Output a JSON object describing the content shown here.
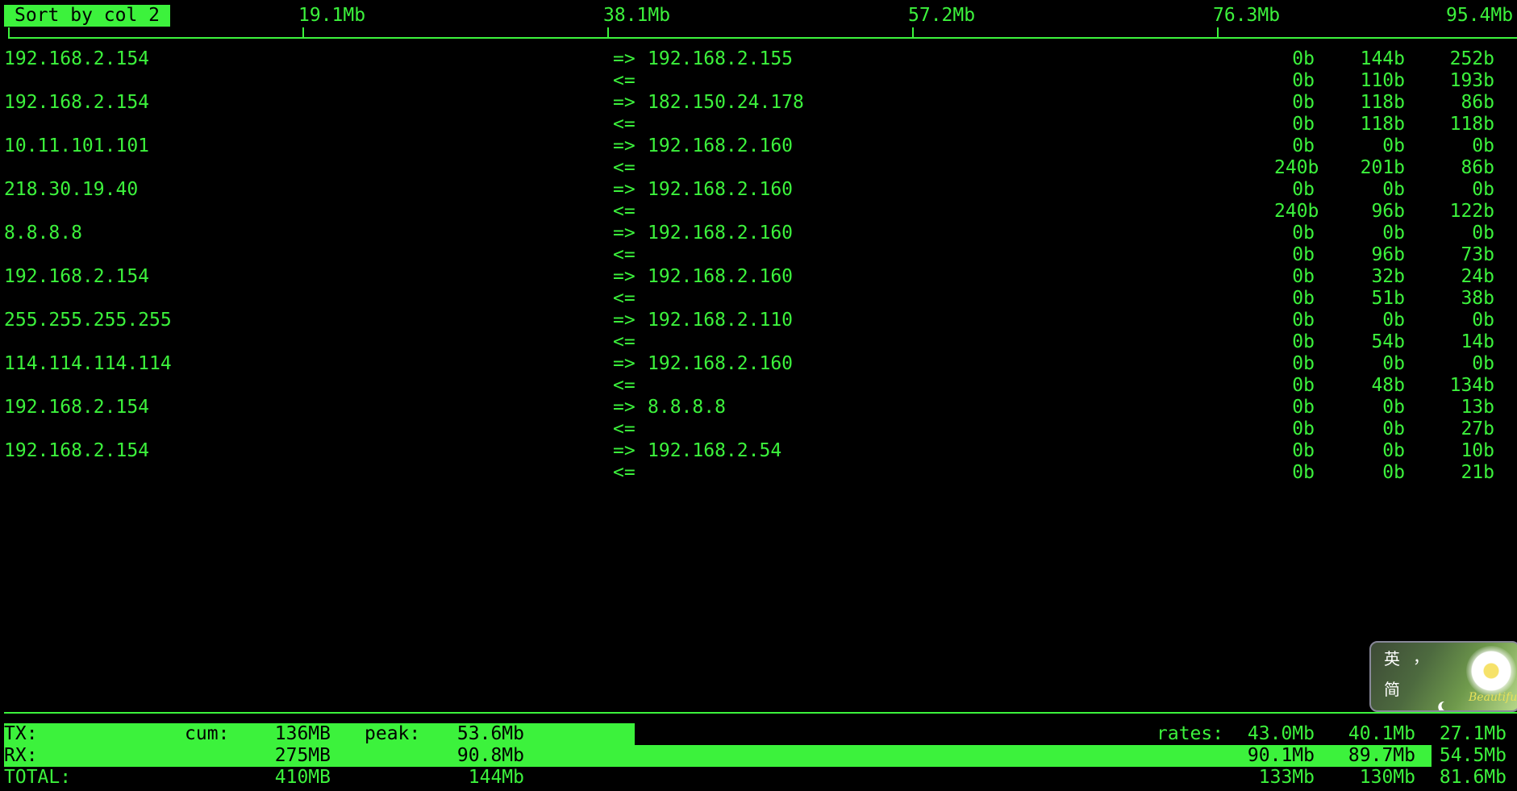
{
  "header": {
    "sort_label": "Sort by col 2",
    "scale": [
      "19.1Mb",
      "38.1Mb",
      "57.2Mb",
      "76.3Mb",
      "95.4Mb"
    ]
  },
  "connections": [
    {
      "host": "192.168.2.154",
      "peer": "192.168.2.155",
      "tx": [
        "0b",
        "144b",
        "252b"
      ],
      "rx": [
        "0b",
        "110b",
        "193b"
      ]
    },
    {
      "host": "192.168.2.154",
      "peer": "182.150.24.178",
      "tx": [
        "0b",
        "118b",
        "86b"
      ],
      "rx": [
        "0b",
        "118b",
        "118b"
      ]
    },
    {
      "host": "10.11.101.101",
      "peer": "192.168.2.160",
      "tx": [
        "0b",
        "0b",
        "0b"
      ],
      "rx": [
        "240b",
        "201b",
        "86b"
      ]
    },
    {
      "host": "218.30.19.40",
      "peer": "192.168.2.160",
      "tx": [
        "0b",
        "0b",
        "0b"
      ],
      "rx": [
        "240b",
        "96b",
        "122b"
      ]
    },
    {
      "host": "8.8.8.8",
      "peer": "192.168.2.160",
      "tx": [
        "0b",
        "0b",
        "0b"
      ],
      "rx": [
        "0b",
        "96b",
        "73b"
      ]
    },
    {
      "host": "192.168.2.154",
      "peer": "192.168.2.160",
      "tx": [
        "0b",
        "32b",
        "24b"
      ],
      "rx": [
        "0b",
        "51b",
        "38b"
      ]
    },
    {
      "host": "255.255.255.255",
      "peer": "192.168.2.110",
      "tx": [
        "0b",
        "0b",
        "0b"
      ],
      "rx": [
        "0b",
        "54b",
        "14b"
      ]
    },
    {
      "host": "114.114.114.114",
      "peer": "192.168.2.160",
      "tx": [
        "0b",
        "0b",
        "0b"
      ],
      "rx": [
        "0b",
        "48b",
        "134b"
      ]
    },
    {
      "host": "192.168.2.154",
      "peer": "8.8.8.8",
      "tx": [
        "0b",
        "0b",
        "13b"
      ],
      "rx": [
        "0b",
        "0b",
        "27b"
      ]
    },
    {
      "host": "192.168.2.154",
      "peer": "192.168.2.54",
      "tx": [
        "0b",
        "0b",
        "10b"
      ],
      "rx": [
        "0b",
        "0b",
        "21b"
      ]
    }
  ],
  "arrows": {
    "out": "=>",
    "in": "<="
  },
  "totals": {
    "tx": {
      "label": "TX:",
      "cum_label": "cum:",
      "cum": "136MB",
      "peak_label": "peak:",
      "peak": "53.6Mb",
      "rates_label": "rates:",
      "rates": [
        "43.0Mb",
        "40.1Mb",
        "27.1Mb"
      ],
      "bar_fraction": 0.418
    },
    "rx": {
      "label": "RX:",
      "cum": "275MB",
      "peak": "90.8Mb",
      "rates": [
        "90.1Mb",
        "89.7Mb",
        "54.5Mb"
      ],
      "bar_fraction": 0.946
    },
    "total": {
      "label": "TOTAL:",
      "cum": "410MB",
      "peak": "144Mb",
      "rates": [
        "133Mb",
        "130Mb",
        "81.6Mb"
      ]
    }
  },
  "ime": {
    "lang_key": "英",
    "punct_key": "，",
    "script_key": "简",
    "mode_icon": "moon-icon",
    "caption": "Beautiful"
  },
  "colors": {
    "fg": "#3cf23c",
    "bg": "#000000"
  }
}
